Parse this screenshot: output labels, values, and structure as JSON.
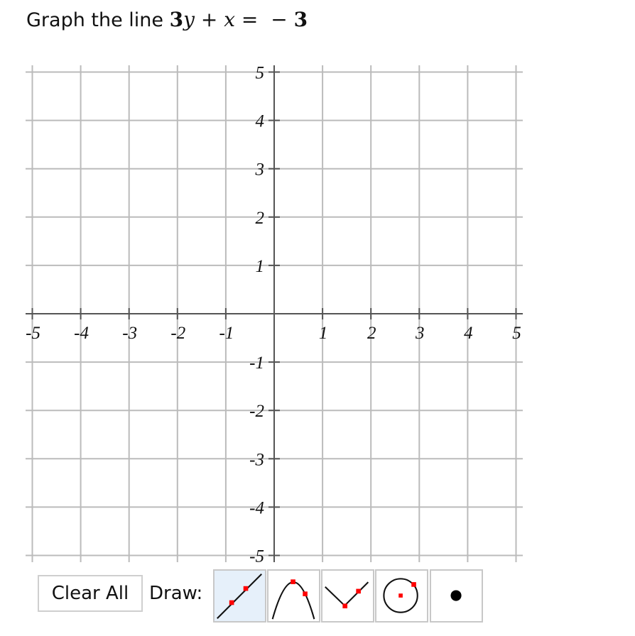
{
  "prompt": {
    "text": "Graph the line",
    "equation_parts": {
      "coef": "3",
      "y": "y",
      "plus": "+",
      "x": "x",
      "equals": "=",
      "minus": "−",
      "rhs": "3"
    }
  },
  "graph": {
    "x_range": [
      -5,
      5
    ],
    "y_range": [
      -5,
      5
    ],
    "x_tick_labels": [
      "-5",
      "-4",
      "-3",
      "-2",
      "-1",
      "1",
      "2",
      "3",
      "4",
      "5"
    ],
    "y_tick_labels": [
      "5",
      "4",
      "3",
      "2",
      "1",
      "-1",
      "-2",
      "-3",
      "-4",
      "-5"
    ],
    "grid_color": "#bbbbbb",
    "axis_color": "#555555",
    "plotted_items": []
  },
  "toolbar": {
    "clear_label": "Clear All",
    "draw_label": "Draw:",
    "tools": [
      {
        "name": "line",
        "active": true
      },
      {
        "name": "parabola",
        "active": false
      },
      {
        "name": "absolute-value",
        "active": false
      },
      {
        "name": "circle",
        "active": false
      },
      {
        "name": "point",
        "active": false
      }
    ],
    "active_bg": "#e6f0fa",
    "point_color": "#ff0000"
  }
}
